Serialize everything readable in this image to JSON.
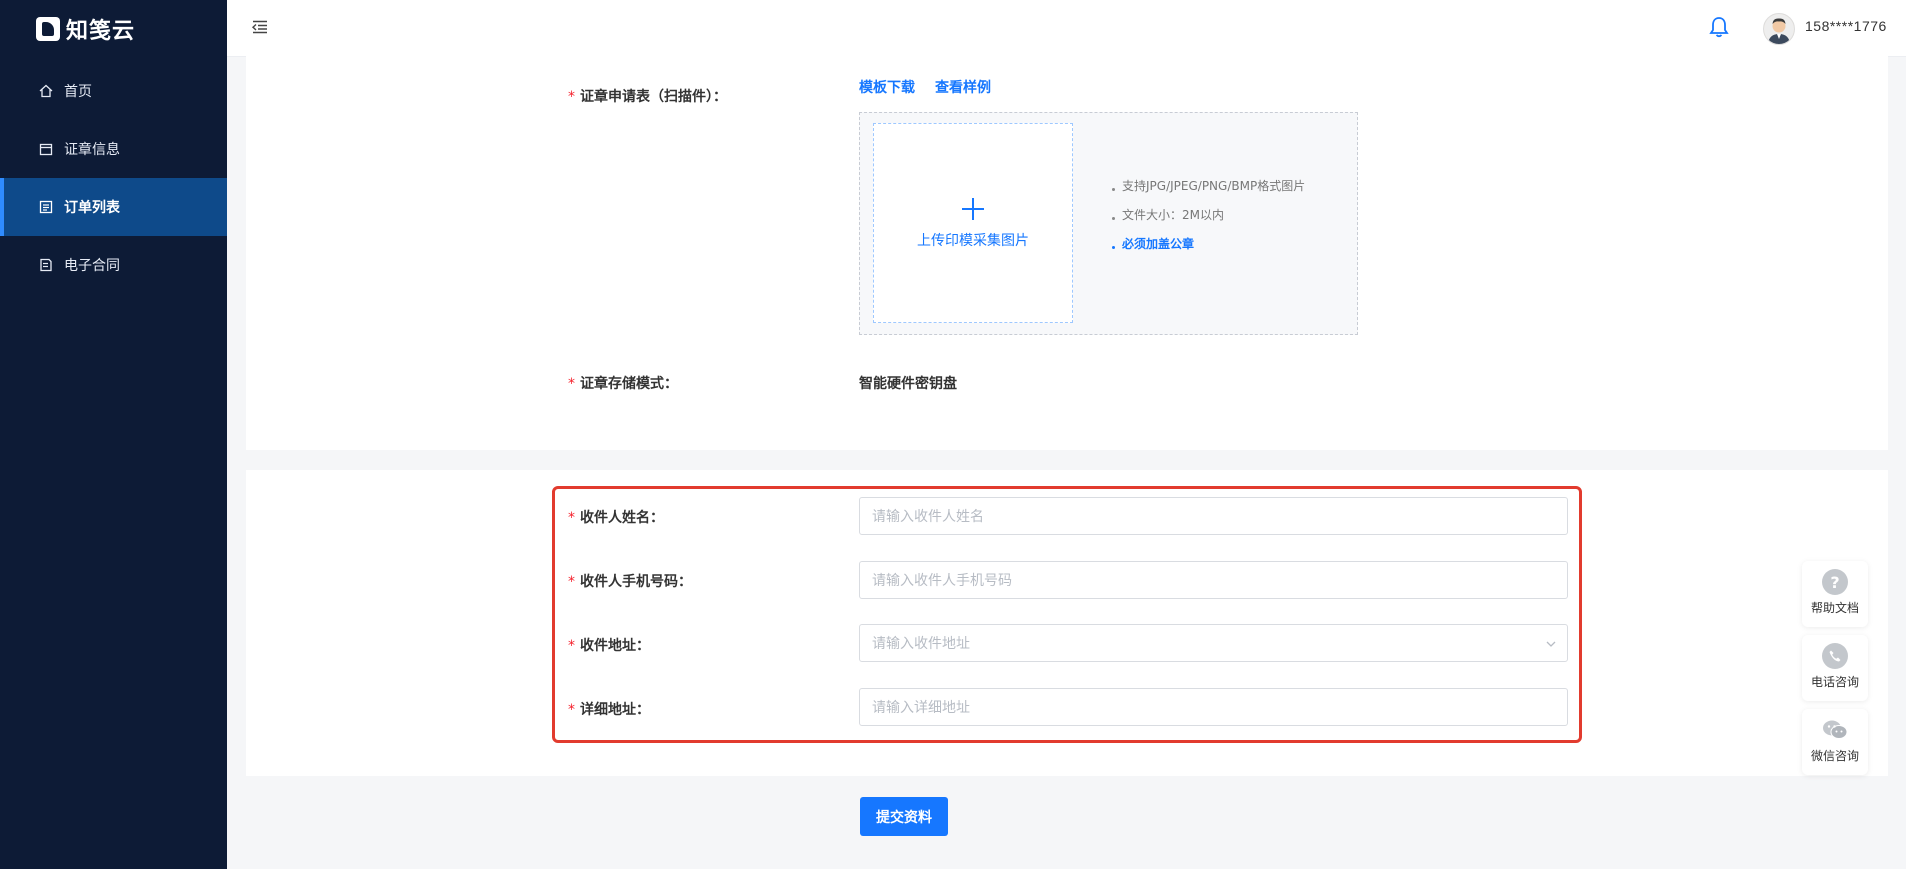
{
  "app": {
    "logo_text": "知笺云"
  },
  "sidebar": {
    "items": [
      {
        "label": "首页",
        "icon": "home-icon"
      },
      {
        "label": "证章信息",
        "icon": "calendar-icon"
      },
      {
        "label": "订单列表",
        "icon": "list-icon",
        "active": true
      },
      {
        "label": "电子合同",
        "icon": "contract-icon"
      }
    ]
  },
  "header": {
    "username": "158****1776"
  },
  "form": {
    "application": {
      "label": "证章申请表（扫描件）：",
      "template_link": "模板下载",
      "sample_link": "查看样例",
      "upload_text": "上传印模采集图片",
      "tips": [
        "支持JPG/JPEG/PNG/BMP格式图片",
        "文件大小：2M以内",
        "必须加盖公章"
      ]
    },
    "storage": {
      "label": "证章存储模式：",
      "value": "智能硬件密钥盘"
    },
    "recipient_name": {
      "label": "收件人姓名：",
      "placeholder": "请输入收件人姓名"
    },
    "recipient_phone": {
      "label": "收件人手机号码：",
      "placeholder": "请输入收件人手机号码"
    },
    "address": {
      "label": "收件地址：",
      "placeholder": "请输入收件地址"
    },
    "detail_address": {
      "label": "详细地址：",
      "placeholder": "请输入详细地址"
    },
    "submit_label": "提交资料"
  },
  "float_tools": [
    {
      "label": "帮助文档",
      "icon": "help-icon"
    },
    {
      "label": "电话咨询",
      "icon": "phone-icon"
    },
    {
      "label": "微信咨询",
      "icon": "wechat-icon"
    }
  ],
  "colors": {
    "sidebar_bg": "#0d1b36",
    "active_bg": "#0e4a8a",
    "accent": "#1677ff",
    "highlight": "#e23b2e"
  }
}
